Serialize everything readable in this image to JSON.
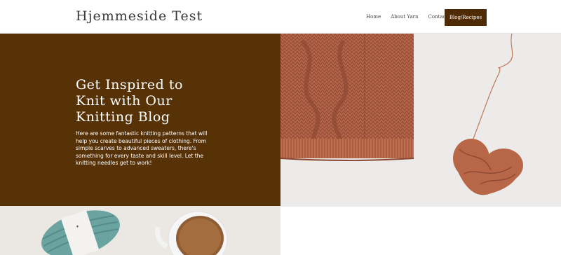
{
  "header": {
    "site_title": "Hjemmeside Test",
    "nav": [
      {
        "label": "Home"
      },
      {
        "label": "About Yarn"
      },
      {
        "label": "Contact"
      }
    ],
    "cta_label": "Blog/Recipes"
  },
  "hero": {
    "heading": "Get Inspired to Knit with Our Knitting Blog",
    "body": "Here are some fantastic knitting patterns that will help you create beautiful pieces of clothing. From simple scarves to advanced sweaters, there's something for every taste and skill level. Let the knitting needles get to work!"
  },
  "colors": {
    "accent_brown": "#573207",
    "button_brown": "#4f2b05",
    "knit_terracotta": "#b8674a"
  }
}
